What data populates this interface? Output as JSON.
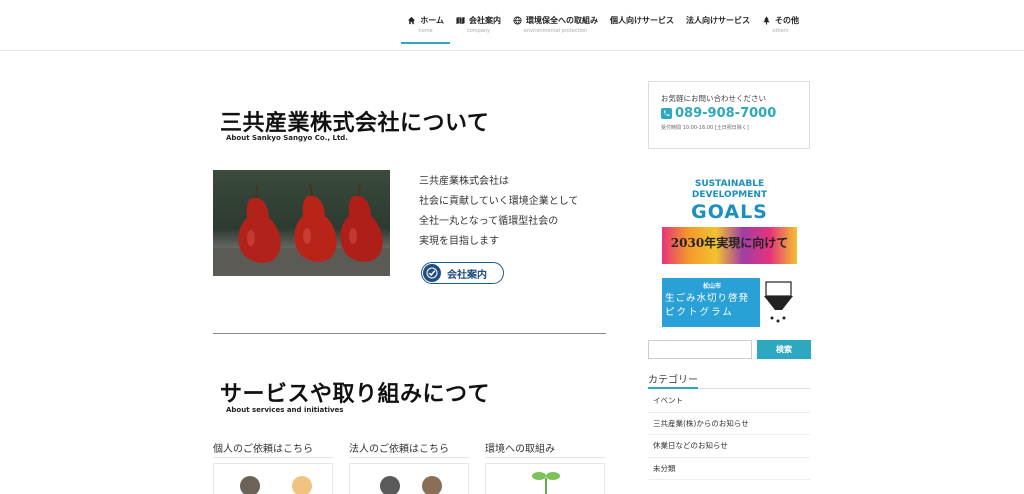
{
  "nav": [
    {
      "label": "ホーム",
      "sub": "home",
      "icon": "home-icon"
    },
    {
      "label": "会社案内",
      "sub": "company",
      "icon": "map-icon"
    },
    {
      "label": "環境保全への取組み",
      "sub": "environmental protection",
      "icon": "globe-icon"
    },
    {
      "label": "個人向けサービス",
      "sub": "",
      "icon": ""
    },
    {
      "label": "法人向けサービス",
      "sub": "",
      "icon": ""
    },
    {
      "label": "その他",
      "sub": "others",
      "icon": "tree-icon"
    }
  ],
  "about": {
    "title": "三共産業株式会社について",
    "subtitle": "About Sankyo Sangyo Co., Ltd.",
    "lines": [
      "三共産業株式会社は",
      "社会に貢献していく環境企業として",
      "全社一丸となって循環型社会の",
      "実現を目指します"
    ],
    "button": "会社案内"
  },
  "services": {
    "title": "サービスや取り組みにつて",
    "subtitle": "About services and initiatives",
    "cards": [
      {
        "title": "個人のご依頼はこちら"
      },
      {
        "title": "法人のご依頼はこちら"
      },
      {
        "title": "環境への取組み"
      }
    ]
  },
  "sidebar": {
    "contact": {
      "text": "お気軽にお問い合わせください",
      "phone": "089-908-7000",
      "hours": "受付時間 10:00-16:00 [土日祝日除く]"
    },
    "sdgs": {
      "line1": "SUSTAINABLE",
      "line2": "DEVELOPMENT",
      "line3": "GOALS",
      "year": "2030年実現に向けて"
    },
    "pictogram": {
      "city": "松山市",
      "line1": "生ごみ水切り啓発",
      "line2": "ピクトグラム"
    },
    "search": {
      "placeholder": "",
      "button": "検索"
    },
    "categories_title": "カテゴリー",
    "categories": [
      "イベント",
      "三共産業(株)からのお知らせ",
      "休業日などのお知らせ",
      "未分類"
    ]
  },
  "colors": {
    "accent": "#2da8bf",
    "navy": "#1f4f7f",
    "sdgs_blue": "#1a8fc0"
  }
}
